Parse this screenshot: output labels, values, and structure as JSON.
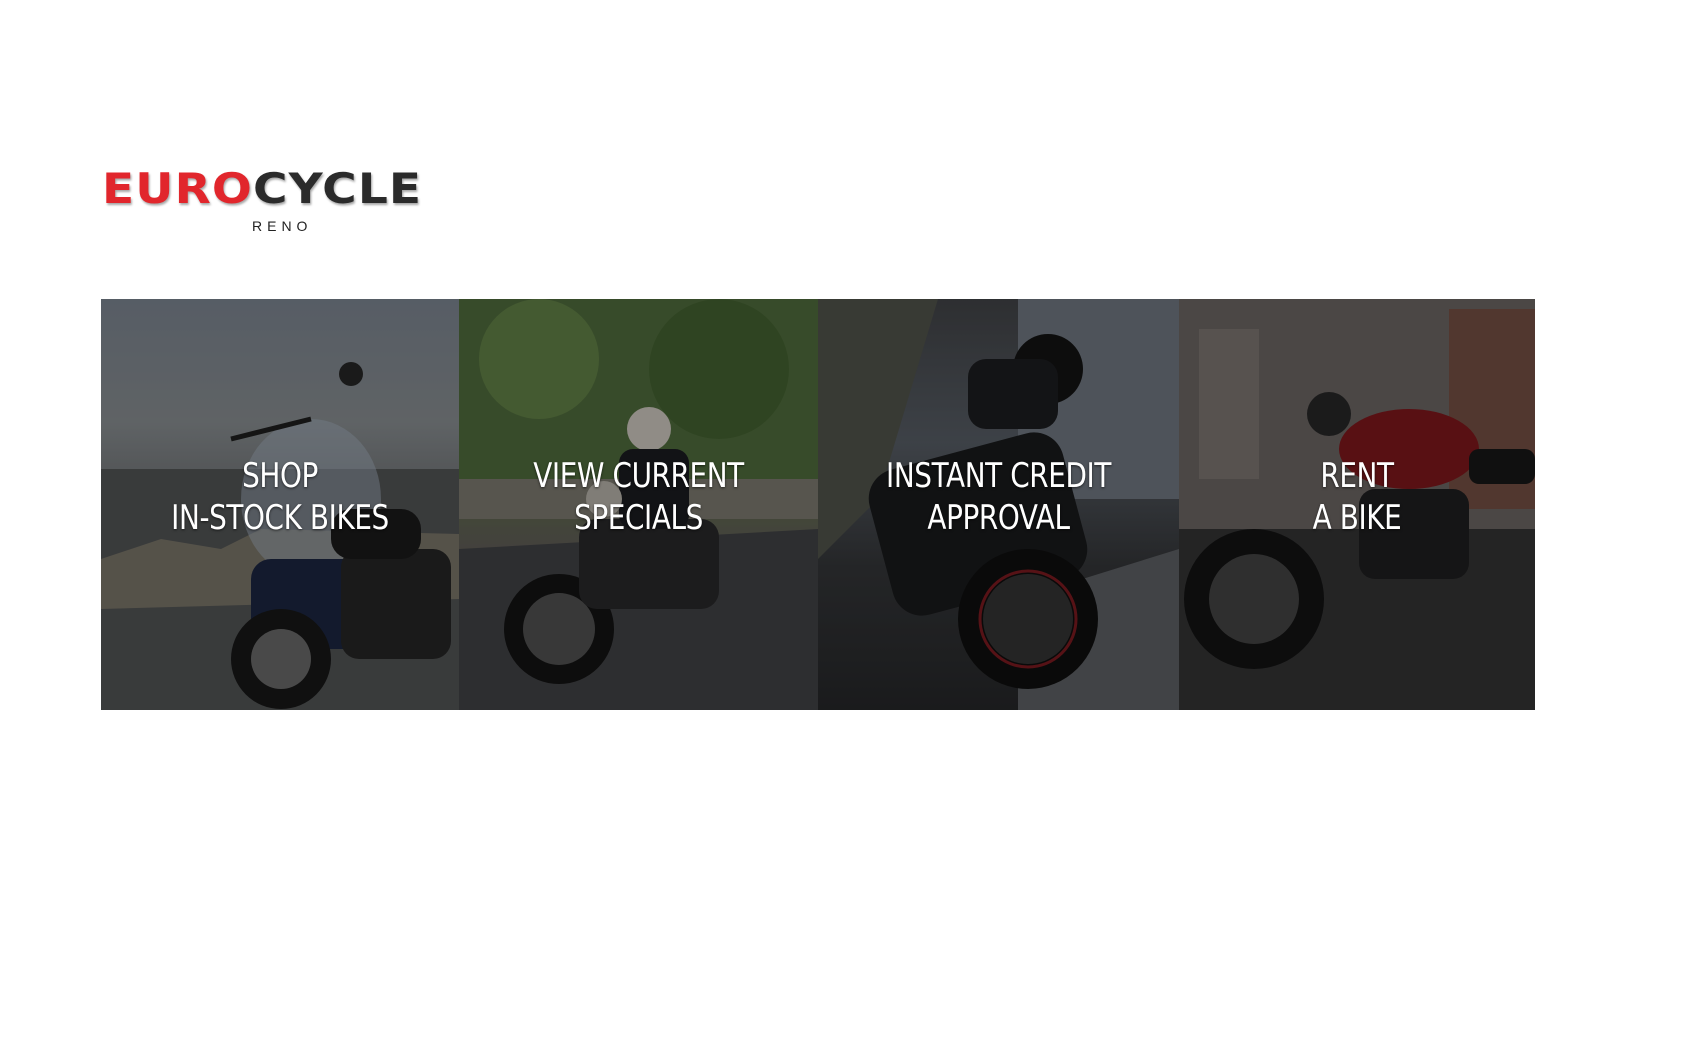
{
  "brand": {
    "name_part1": "EURO",
    "name_part2": "CYCLE",
    "location": "RENO",
    "colors": {
      "red": "#e1262c",
      "dark": "#2b2b2b"
    }
  },
  "tiles": [
    {
      "line1": "SHOP",
      "line2": "IN-STOCK BIKES"
    },
    {
      "line1": "VIEW CURRENT",
      "line2": "SPECIALS"
    },
    {
      "line1": "INSTANT CREDIT",
      "line2": "APPROVAL"
    },
    {
      "line1": "RENT",
      "line2": "A BIKE"
    }
  ]
}
